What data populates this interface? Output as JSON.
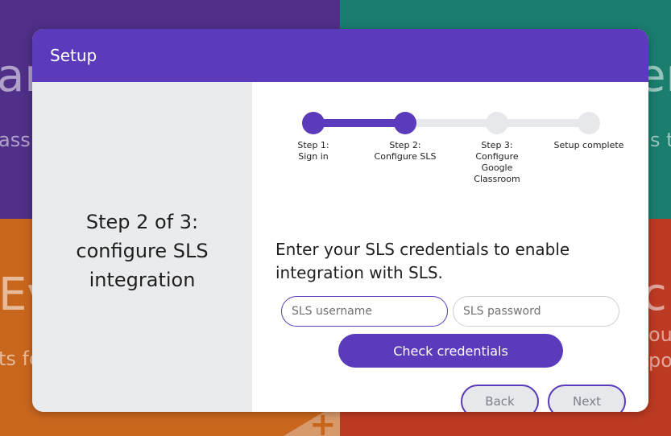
{
  "background": {
    "tiles": {
      "top_left": {
        "big_text": "an",
        "small_text": "ass"
      },
      "top_right": {
        "big_text": "er",
        "small_text": "s th"
      },
      "bottom_left": {
        "big_text": "Ev",
        "small_text": "ts fo"
      },
      "bottom_right": {
        "big_text": "c",
        "small_text_1": "ou",
        "small_text_2": "poi"
      }
    },
    "colors": {
      "purple": "#4f2f87",
      "teal": "#1a7d6e",
      "orange": "#c9661d",
      "red": "#bd3a22"
    }
  },
  "dialog": {
    "title": "Setup",
    "left_panel": {
      "heading_line1": "Step 2 of 3:",
      "heading_line2": "configure SLS",
      "heading_line3": "integration"
    },
    "stepper": {
      "steps": [
        {
          "label": "Step 1:\nSign in",
          "state": "done"
        },
        {
          "label": "Step 2:\nConfigure SLS",
          "state": "current"
        },
        {
          "label": "Step 3:\nConfigure\nGoogle\nClassroom",
          "state": "pending"
        },
        {
          "label": "Setup complete",
          "state": "pending"
        }
      ]
    },
    "prompt": "Enter your SLS credentials to enable integration with SLS.",
    "username": {
      "value": "",
      "placeholder": "SLS username"
    },
    "password": {
      "value": "",
      "placeholder": "SLS password"
    },
    "check_button_label": "Check credentials",
    "back_button_label": "Back",
    "next_button_label": "Next",
    "accent_color": "#5b3bbb"
  }
}
